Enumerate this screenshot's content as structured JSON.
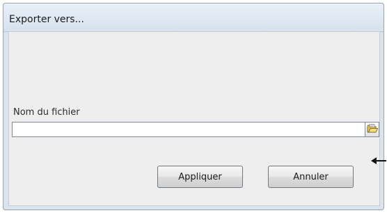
{
  "window": {
    "title": "Exporter vers..."
  },
  "form": {
    "file_label": "Nom du fichier",
    "file_value": "",
    "browse_icon": "folder-open-icon"
  },
  "buttons": {
    "apply_label": "Appliquer",
    "cancel_label": "Annuler"
  },
  "annotation": {
    "pointer_icon": "arrow-left-icon"
  }
}
